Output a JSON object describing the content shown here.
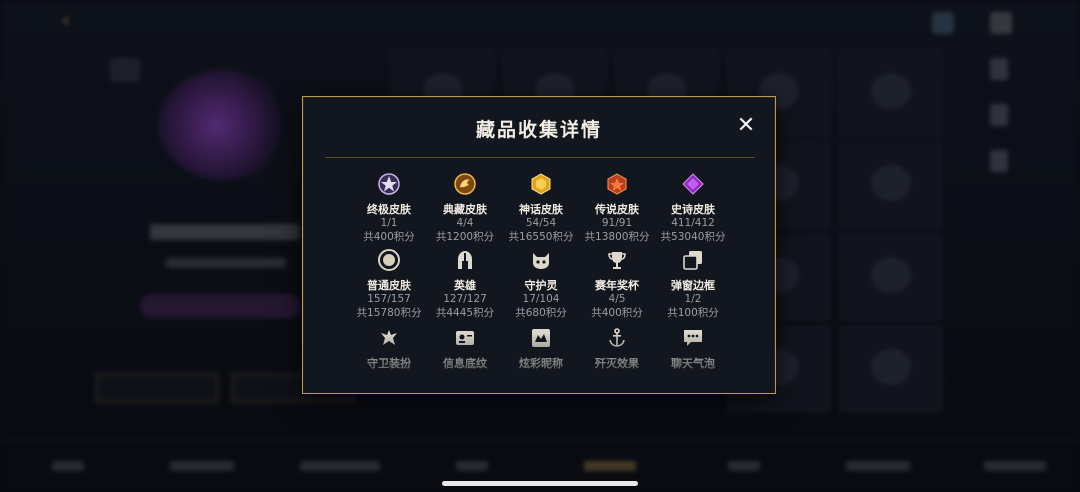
{
  "modal": {
    "title": "藏品收集详情",
    "close_symbol": "✕",
    "items": [
      {
        "name": "终极皮肤",
        "count": "1/1",
        "points": "共400积分",
        "icon": "ultimate-skin-icon",
        "color": "#b48ae6"
      },
      {
        "name": "典藏皮肤",
        "count": "4/4",
        "points": "共1200积分",
        "icon": "legacy-skin-icon",
        "color": "#d99a2b"
      },
      {
        "name": "神话皮肤",
        "count": "54/54",
        "points": "共16550积分",
        "icon": "mythic-skin-icon",
        "color": "#e5b52e"
      },
      {
        "name": "传说皮肤",
        "count": "91/91",
        "points": "共13800积分",
        "icon": "legendary-skin-icon",
        "color": "#e5612a"
      },
      {
        "name": "史诗皮肤",
        "count": "411/412",
        "points": "共53040积分",
        "icon": "epic-skin-icon",
        "color": "#b04ad8"
      },
      {
        "name": "普通皮肤",
        "count": "157/157",
        "points": "共15780积分",
        "icon": "normal-skin-icon",
        "color": "#c9c2b2"
      },
      {
        "name": "英雄",
        "count": "127/127",
        "points": "共4445积分",
        "icon": "hero-helmet-icon",
        "color": "#d8d4ca"
      },
      {
        "name": "守护灵",
        "count": "17/104",
        "points": "共680积分",
        "icon": "guardian-spirit-icon",
        "color": "#d8d4ca"
      },
      {
        "name": "赛年奖杯",
        "count": "4/5",
        "points": "共400积分",
        "icon": "trophy-icon",
        "color": "#d8d4ca"
      },
      {
        "name": "弹窗边框",
        "count": "1/2",
        "points": "共100积分",
        "icon": "popup-frame-icon",
        "color": "#d8d4ca"
      },
      {
        "name": "守卫装扮",
        "icon": "ward-skin-icon",
        "color": "#d8d4ca"
      },
      {
        "name": "信息底纹",
        "icon": "info-texture-icon",
        "color": "#d8d4ca"
      },
      {
        "name": "炫彩昵称",
        "icon": "colorful-nickname-icon",
        "color": "#d8d4ca"
      },
      {
        "name": "歼灭效果",
        "icon": "kill-effect-icon",
        "color": "#d8d4ca"
      },
      {
        "name": "聊天气泡",
        "icon": "chat-bubble-icon",
        "color": "#d8d4ca"
      }
    ]
  },
  "colors": {
    "modal_border": "#b79a58",
    "modal_bg": "#11161f",
    "accent_gold": "#c9a45a"
  }
}
